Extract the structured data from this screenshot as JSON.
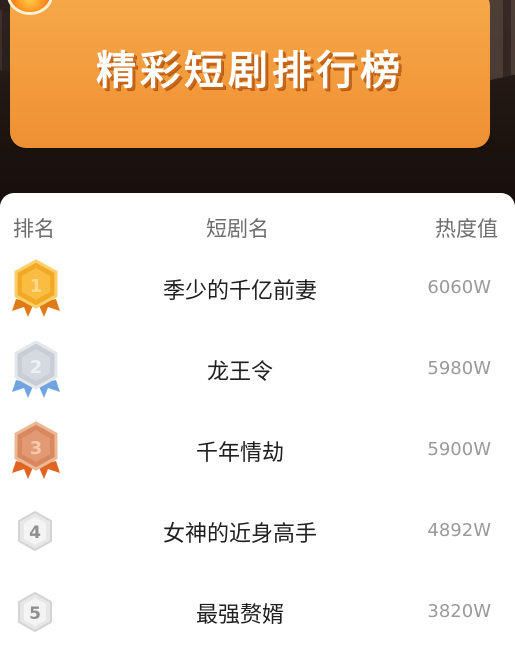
{
  "banner": {
    "title": "精彩短剧排行榜"
  },
  "table_header": {
    "rank": "排名",
    "name": "短剧名",
    "heat": "热度值"
  },
  "rows": [
    {
      "rank": "1",
      "title": "季少的千亿前妻",
      "heat": "6060W",
      "medal": "gold"
    },
    {
      "rank": "2",
      "title": "龙王令",
      "heat": "5980W",
      "medal": "silver"
    },
    {
      "rank": "3",
      "title": "千年情劫",
      "heat": "5900W",
      "medal": "bronze"
    },
    {
      "rank": "4",
      "title": "女神的近身高手",
      "heat": "4892W",
      "medal": "plain"
    },
    {
      "rank": "5",
      "title": "最强赘婿",
      "heat": "3820W",
      "medal": "plain"
    }
  ],
  "colors": {
    "banner": "#f29a3c",
    "gold": "#f3a925",
    "silver": "#c8cdd6",
    "bronze": "#d8875e",
    "plain": "#8f8f8f"
  }
}
